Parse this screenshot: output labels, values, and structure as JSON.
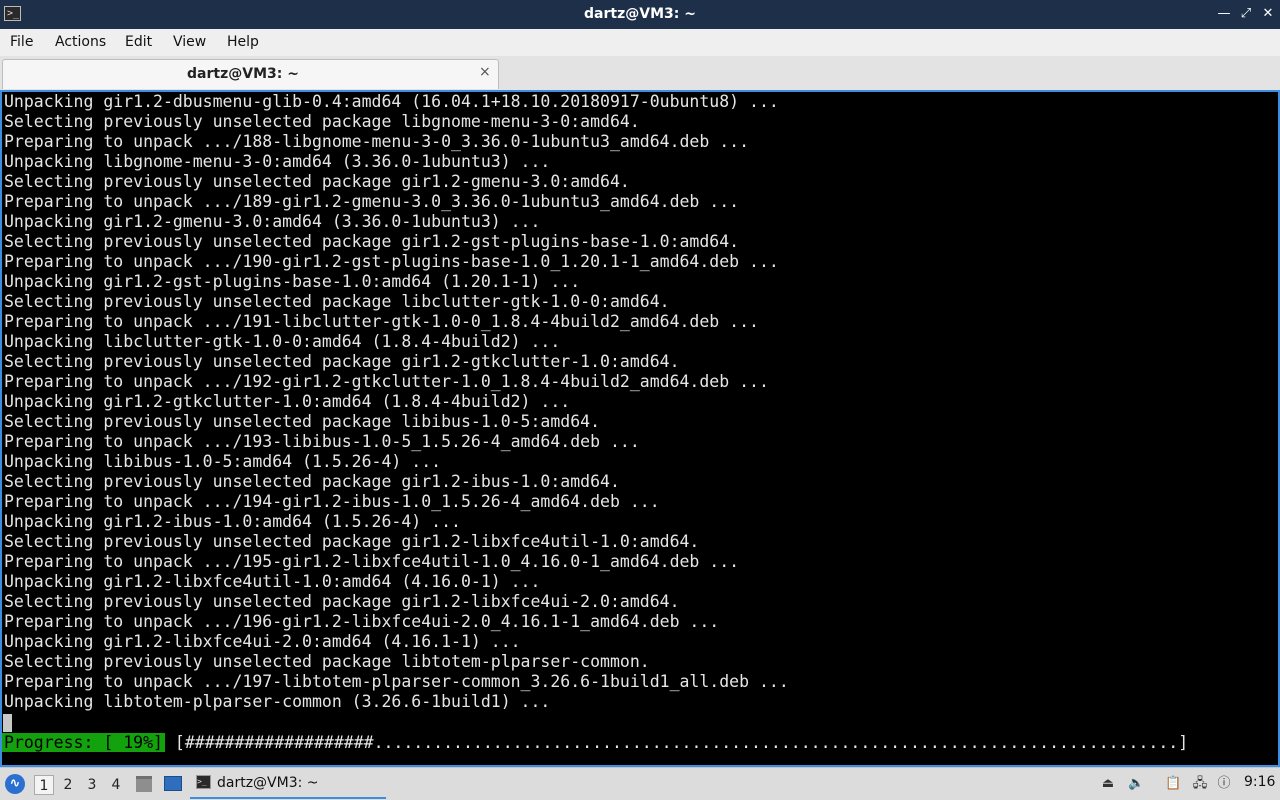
{
  "window": {
    "title": "dartz@VM3: ~",
    "app_icon": "terminal-icon",
    "controls": {
      "minimize": "minimize-icon",
      "maximize": "maximize-icon",
      "close": "close-icon"
    }
  },
  "menu": [
    "File",
    "Actions",
    "Edit",
    "View",
    "Help"
  ],
  "tab": {
    "label": "dartz@VM3: ~",
    "close_glyph": "×"
  },
  "terminal": {
    "lines": [
      "Unpacking gir1.2-dbusmenu-glib-0.4:amd64 (16.04.1+18.10.20180917-0ubuntu8) ...",
      "Selecting previously unselected package libgnome-menu-3-0:amd64.",
      "Preparing to unpack .../188-libgnome-menu-3-0_3.36.0-1ubuntu3_amd64.deb ...",
      "Unpacking libgnome-menu-3-0:amd64 (3.36.0-1ubuntu3) ...",
      "Selecting previously unselected package gir1.2-gmenu-3.0:amd64.",
      "Preparing to unpack .../189-gir1.2-gmenu-3.0_3.36.0-1ubuntu3_amd64.deb ...",
      "Unpacking gir1.2-gmenu-3.0:amd64 (3.36.0-1ubuntu3) ...",
      "Selecting previously unselected package gir1.2-gst-plugins-base-1.0:amd64.",
      "Preparing to unpack .../190-gir1.2-gst-plugins-base-1.0_1.20.1-1_amd64.deb ...",
      "Unpacking gir1.2-gst-plugins-base-1.0:amd64 (1.20.1-1) ...",
      "Selecting previously unselected package libclutter-gtk-1.0-0:amd64.",
      "Preparing to unpack .../191-libclutter-gtk-1.0-0_1.8.4-4build2_amd64.deb ...",
      "Unpacking libclutter-gtk-1.0-0:amd64 (1.8.4-4build2) ...",
      "Selecting previously unselected package gir1.2-gtkclutter-1.0:amd64.",
      "Preparing to unpack .../192-gir1.2-gtkclutter-1.0_1.8.4-4build2_amd64.deb ...",
      "Unpacking gir1.2-gtkclutter-1.0:amd64 (1.8.4-4build2) ...",
      "Selecting previously unselected package libibus-1.0-5:amd64.",
      "Preparing to unpack .../193-libibus-1.0-5_1.5.26-4_amd64.deb ...",
      "Unpacking libibus-1.0-5:amd64 (1.5.26-4) ...",
      "Selecting previously unselected package gir1.2-ibus-1.0:amd64.",
      "Preparing to unpack .../194-gir1.2-ibus-1.0_1.5.26-4_amd64.deb ...",
      "Unpacking gir1.2-ibus-1.0:amd64 (1.5.26-4) ...",
      "Selecting previously unselected package gir1.2-libxfce4util-1.0:amd64.",
      "Preparing to unpack .../195-gir1.2-libxfce4util-1.0_4.16.0-1_amd64.deb ...",
      "Unpacking gir1.2-libxfce4util-1.0:amd64 (4.16.0-1) ...",
      "Selecting previously unselected package gir1.2-libxfce4ui-2.0:amd64.",
      "Preparing to unpack .../196-gir1.2-libxfce4ui-2.0_4.16.1-1_amd64.deb ...",
      "Unpacking gir1.2-libxfce4ui-2.0:amd64 (4.16.1-1) ...",
      "Selecting previously unselected package libtotem-plparser-common.",
      "Preparing to unpack .../197-libtotem-plparser-common_3.26.6-1build1_all.deb ...",
      "Unpacking libtotem-plparser-common (3.26.6-1build1) ..."
    ],
    "progress": {
      "label": "Progress: [ 19%]",
      "percent": 19,
      "bar": "[###################.................................................................................]"
    }
  },
  "taskbar": {
    "start_icon": "start-menu-icon",
    "workspaces": [
      "1",
      "2",
      "3",
      "4"
    ],
    "active_workspace": "1",
    "launchers": [
      "file-manager-icon",
      "show-desktop-icon"
    ],
    "window_task": {
      "label": "dartz@VM3: ~",
      "icon": "terminal-icon"
    },
    "tray": [
      "eject-icon",
      "volume-icon",
      "clipboard-icon",
      "network-icon",
      "update-notifier-icon"
    ],
    "clock": "9:16"
  },
  "colors": {
    "titlebar": "#1d2f49",
    "terminal_bg": "#000000",
    "terminal_fg": "#e6e6e6",
    "progress_badge": "#13a10e",
    "focus_border": "#3d8ee0",
    "taskbar": "#dcdcdc"
  }
}
